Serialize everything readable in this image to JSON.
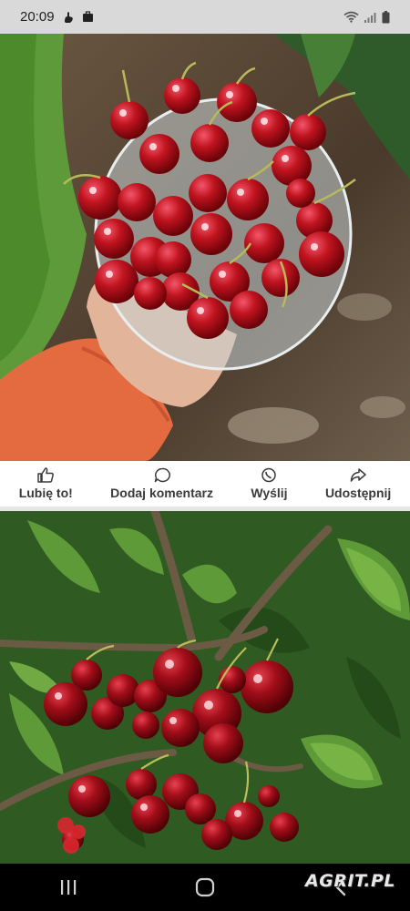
{
  "status_bar": {
    "time": "20:09"
  },
  "actions": {
    "like_label": "Lubię to!",
    "comment_label": "Dodaj komentarz",
    "send_label": "Wyślij",
    "share_label": "Udostępnij"
  },
  "watermark": {
    "text": "AGRIT.PL"
  },
  "colors": {
    "status_bar_bg": "#d9d9d9",
    "action_text": "#3a3a3a",
    "cherry_red": "#b0101c"
  },
  "icons": {
    "status": [
      "gesture-icon",
      "briefcase-icon",
      "wifi-icon",
      "signal-icon",
      "battery-icon"
    ],
    "actions": [
      "thumbs-up-icon",
      "comment-icon",
      "whatsapp-icon",
      "share-icon"
    ],
    "nav": [
      "recents-icon",
      "home-icon",
      "back-icon"
    ]
  }
}
